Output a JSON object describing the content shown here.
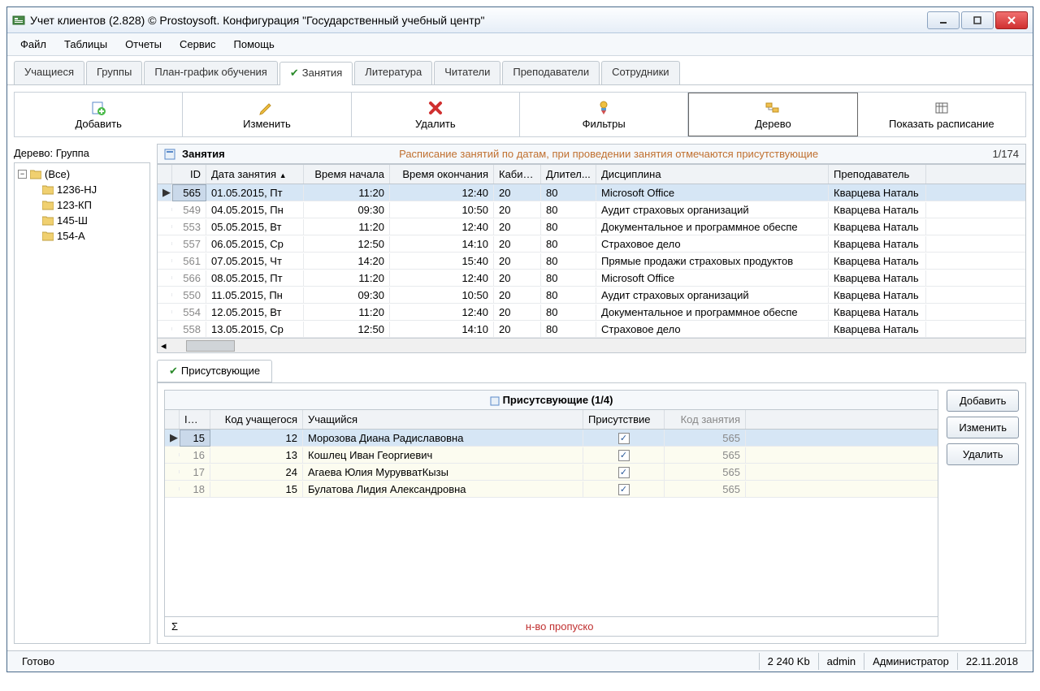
{
  "window": {
    "title": "Учет клиентов (2.828) © Prostoysoft. Конфигурация \"Государственный учебный центр\""
  },
  "menu": {
    "file": "Файл",
    "tables": "Таблицы",
    "reports": "Отчеты",
    "service": "Сервис",
    "help": "Помощь"
  },
  "tabs": {
    "students": "Учащиеся",
    "groups": "Группы",
    "plan": "План-график обучения",
    "lessons": "Занятия",
    "literature": "Литература",
    "readers": "Читатели",
    "teachers": "Преподаватели",
    "staff": "Сотрудники"
  },
  "toolbar": {
    "add": "Добавить",
    "edit": "Изменить",
    "delete": "Удалить",
    "filters": "Фильтры",
    "tree": "Дерево",
    "schedule": "Показать расписание"
  },
  "sidebar": {
    "label": "Дерево: Группа",
    "root": "(Все)",
    "items": [
      "1236-HJ",
      "123-КП",
      "145-Ш",
      "154-А"
    ]
  },
  "panel": {
    "title": "Занятия",
    "subtitle": "Расписание занятий по датам, при проведении занятия отмечаются присутствующие",
    "counter": "1/174"
  },
  "grid": {
    "headers": {
      "id": "ID",
      "date": "Дата занятия",
      "start": "Время начала",
      "end": "Время окончания",
      "room": "Кабинет",
      "dur": "Длител...",
      "disc": "Дисциплина",
      "teacher": "Преподаватель"
    },
    "rows": [
      {
        "id": "565",
        "date": "01.05.2015, Пт",
        "start": "11:20",
        "end": "12:40",
        "room": "20",
        "dur": "80",
        "disc": "Microsoft Office",
        "teacher": "Кварцева Наталь",
        "sel": true
      },
      {
        "id": "549",
        "date": "04.05.2015, Пн",
        "start": "09:30",
        "end": "10:50",
        "room": "20",
        "dur": "80",
        "disc": "Аудит страховых организаций",
        "teacher": "Кварцева Наталь"
      },
      {
        "id": "553",
        "date": "05.05.2015, Вт",
        "start": "11:20",
        "end": "12:40",
        "room": "20",
        "dur": "80",
        "disc": "Документальное и программное обеспе",
        "teacher": "Кварцева Наталь"
      },
      {
        "id": "557",
        "date": "06.05.2015, Ср",
        "start": "12:50",
        "end": "14:10",
        "room": "20",
        "dur": "80",
        "disc": "Страховое дело",
        "teacher": "Кварцева Наталь"
      },
      {
        "id": "561",
        "date": "07.05.2015, Чт",
        "start": "14:20",
        "end": "15:40",
        "room": "20",
        "dur": "80",
        "disc": "Прямые продажи страховых продуктов",
        "teacher": "Кварцева Наталь"
      },
      {
        "id": "566",
        "date": "08.05.2015, Пт",
        "start": "11:20",
        "end": "12:40",
        "room": "20",
        "dur": "80",
        "disc": "Microsoft Office",
        "teacher": "Кварцева Наталь"
      },
      {
        "id": "550",
        "date": "11.05.2015, Пн",
        "start": "09:30",
        "end": "10:50",
        "room": "20",
        "dur": "80",
        "disc": "Аудит страховых организаций",
        "teacher": "Кварцева Наталь"
      },
      {
        "id": "554",
        "date": "12.05.2015, Вт",
        "start": "11:20",
        "end": "12:40",
        "room": "20",
        "dur": "80",
        "disc": "Документальное и программное обеспе",
        "teacher": "Кварцева Наталь"
      },
      {
        "id": "558",
        "date": "13.05.2015, Ср",
        "start": "12:50",
        "end": "14:10",
        "room": "20",
        "dur": "80",
        "disc": "Страховое дело",
        "teacher": "Кварцева Наталь"
      }
    ]
  },
  "subtab": {
    "label": "Присутсвующие"
  },
  "subpanel": {
    "title": "Присутсвующие (1/4)",
    "headers": {
      "id": "ID",
      "code": "Код учащегося",
      "name": "Учащийся",
      "presence": "Присутствие",
      "lesson": "Код занятия"
    },
    "rows": [
      {
        "id": "15",
        "code": "12",
        "name": "Морозова Диана Радиславовна",
        "pres": true,
        "lesson": "565",
        "sel": true
      },
      {
        "id": "16",
        "code": "13",
        "name": "Кошлец Иван Георгиевич",
        "pres": true,
        "lesson": "565"
      },
      {
        "id": "17",
        "code": "24",
        "name": "Агаева Юлия МурувватКызы",
        "pres": true,
        "lesson": "565"
      },
      {
        "id": "18",
        "code": "15",
        "name": "Булатова Лидия Александровна",
        "pres": true,
        "lesson": "565"
      }
    ],
    "sigma": "Σ",
    "sum_label": "н-во пропуско"
  },
  "sidebtns": {
    "add": "Добавить",
    "edit": "Изменить",
    "delete": "Удалить"
  },
  "status": {
    "ready": "Готово",
    "mem": "2 240 Kb",
    "user": "admin",
    "role": "Администратор",
    "date": "22.11.2018"
  }
}
